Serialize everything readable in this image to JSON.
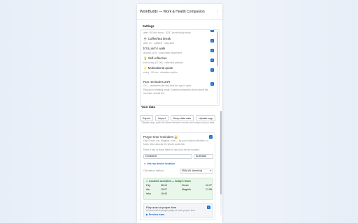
{
  "app": {
    "title": "WorkBuddy — Work & Health Companion",
    "menu_glyph": "⋮"
  },
  "settings": {
    "label": "Settings",
    "top_clip": "after ~52 min focus · 52/17 productivity study",
    "items": [
      {
        "icon": "☕",
        "name": "Coffee/tea break",
        "sub": "after 2 h · caffeine · stay alert",
        "checked": true
      },
      {
        "icon": "🍽",
        "name": "Lunch / walk",
        "sub": "around 12:00 · post-meal movement",
        "checked": true
      },
      {
        "icon": "💡",
        "name": "Self-reflection",
        "sub": "end of day (17:00) · reflective practice",
        "checked": true
      },
      {
        "icon": "✨",
        "name": "Motivational quote",
        "sub": "every ~90 min · ultradian rhythm",
        "checked": true
      }
    ],
    "run_247": {
      "name": "Run reminders 24/7",
      "sub": "On — reminders fire any time the app is open",
      "note": "Paused in Meeting mode. Enabled reminders show where the reminder should fire.",
      "checked": true
    }
  },
  "your_data": {
    "title": "Your data",
    "buttons": [
      "Export",
      "Import",
      "Keep data safe",
      "Update app"
    ],
    "hint": "\"Update app\" pulls the latest released version and keeps all your data."
  },
  "prayer": {
    "title": "Prayer time reminders 🕌",
    "sub": "Fajr, Dhuhr, Asr, Maghrib, Isha — by your location (Muslim, no fuss). Also unlocks the Quran audio tab.",
    "city_hint": "Enter a city or leave blank to use your device location.",
    "city": "Dockland",
    "country": "Australia",
    "use_location": "Use my device location",
    "calc_label": "Calculation method",
    "calc_value": "ISNA (N. America)",
    "status_title": "✓ Location accepted — today's times",
    "times": [
      {
        "name": "Fajr",
        "time": "06:10"
      },
      {
        "name": "Dhuhr",
        "time": "12:27"
      },
      {
        "name": "Asr",
        "time": "15:27"
      },
      {
        "name": "Maghrib",
        "time": "17:58"
      },
      {
        "name": "Isha",
        "time": "19:43"
      }
    ],
    "adhan": {
      "title": "Play azan at prayer time",
      "sub": "A short call-to-prayer plays at each prayer time.",
      "preview": "▶ Preview azan",
      "checked": true
    },
    "enabled": true
  },
  "colors": {
    "accent": "#1a6fd1",
    "success_bg": "#e9f6ea"
  }
}
